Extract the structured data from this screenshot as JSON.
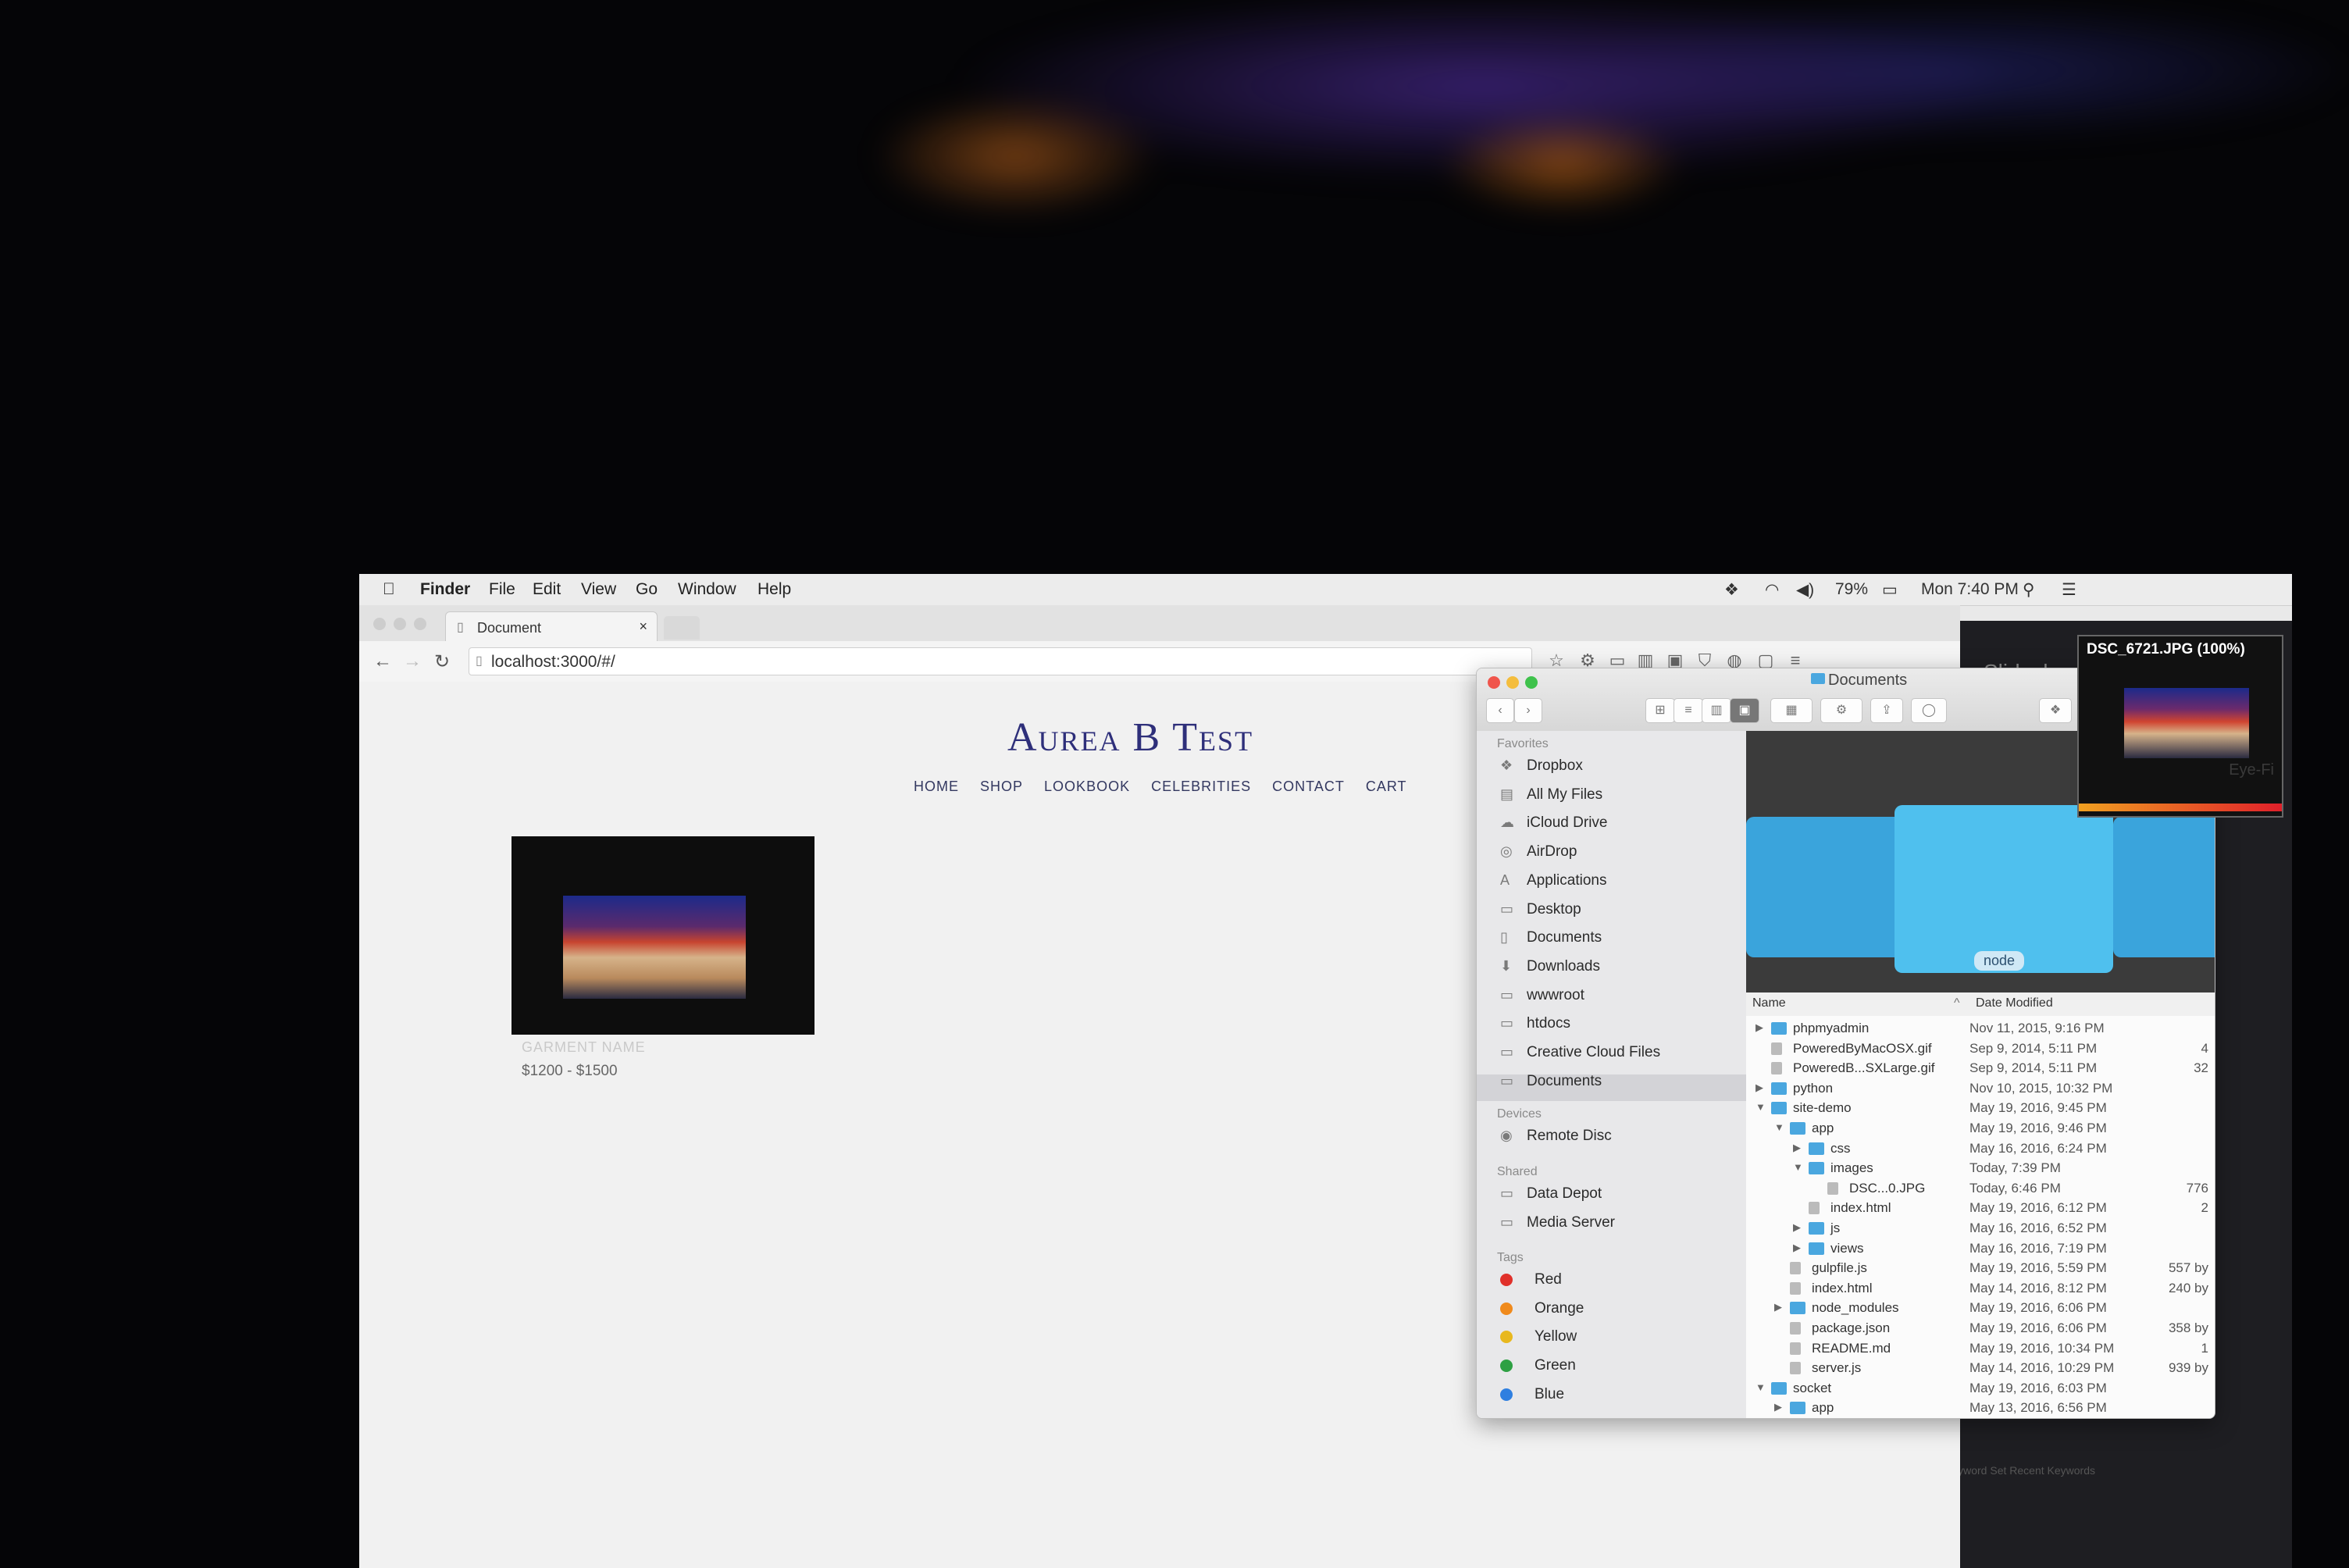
{
  "menubar": {
    "app_name": "Finder",
    "menus": [
      "File",
      "Edit",
      "View",
      "Go",
      "Window",
      "Help"
    ],
    "battery": "79%",
    "clock": "Mon 7:40 PM"
  },
  "browser": {
    "tab_title": "Document",
    "tab_close": "×",
    "url": "localhost:3000/#/",
    "page": {
      "site_title": "Aurea B Test",
      "nav": [
        "HOME",
        "SHOP",
        "LOOKBOOK",
        "CELEBRITIES",
        "CONTACT",
        "CART"
      ],
      "product_name": "GARMENT NAME",
      "product_price": "$1200 - $1500"
    }
  },
  "finder": {
    "title": "Documents",
    "sidebar": {
      "favorites_heading": "Favorites",
      "favorites": [
        {
          "label": "Dropbox",
          "icon": "dropbox-icon"
        },
        {
          "label": "All My Files",
          "icon": "files-icon"
        },
        {
          "label": "iCloud Drive",
          "icon": "cloud-icon"
        },
        {
          "label": "AirDrop",
          "icon": "airdrop-icon"
        },
        {
          "label": "Applications",
          "icon": "applications-icon"
        },
        {
          "label": "Desktop",
          "icon": "desktop-icon"
        },
        {
          "label": "Documents",
          "icon": "document-icon"
        },
        {
          "label": "Downloads",
          "icon": "download-icon"
        },
        {
          "label": "wwwroot",
          "icon": "folder-icon"
        },
        {
          "label": "htdocs",
          "icon": "folder-icon"
        },
        {
          "label": "Creative Cloud Files",
          "icon": "folder-icon"
        },
        {
          "label": "Documents",
          "icon": "folder-icon"
        }
      ],
      "devices_heading": "Devices",
      "devices": [
        {
          "label": "Remote Disc",
          "icon": "disc-icon"
        }
      ],
      "shared_heading": "Shared",
      "shared": [
        {
          "label": "Data Depot",
          "icon": "monitor-icon"
        },
        {
          "label": "Media Server",
          "icon": "monitor-icon"
        }
      ],
      "tags_heading": "Tags",
      "tags": [
        {
          "label": "Red",
          "color": "#e0302a"
        },
        {
          "label": "Orange",
          "color": "#f08a1c"
        },
        {
          "label": "Yellow",
          "color": "#e8b81e"
        },
        {
          "label": "Green",
          "color": "#2ea043"
        },
        {
          "label": "Blue",
          "color": "#2f7fe0"
        }
      ]
    },
    "preview_label": "node",
    "columns": {
      "name": "Name",
      "date": "Date Modified"
    },
    "rows": [
      {
        "name": "phpmyadmin",
        "date": "Nov 11, 2015, 9:16 PM",
        "size": "",
        "indent": 0,
        "kind": "folder",
        "disc": "▶"
      },
      {
        "name": "PoweredByMacOSX.gif",
        "date": "Sep 9, 2014, 5:11 PM",
        "size": "4",
        "indent": 0,
        "kind": "file",
        "disc": ""
      },
      {
        "name": "PoweredB...SXLarge.gif",
        "date": "Sep 9, 2014, 5:11 PM",
        "size": "32",
        "indent": 0,
        "kind": "file",
        "disc": ""
      },
      {
        "name": "python",
        "date": "Nov 10, 2015, 10:32 PM",
        "size": "",
        "indent": 0,
        "kind": "folder",
        "disc": "▶"
      },
      {
        "name": "site-demo",
        "date": "May 19, 2016, 9:45 PM",
        "size": "",
        "indent": 0,
        "kind": "folder",
        "disc": "▼"
      },
      {
        "name": "app",
        "date": "May 19, 2016, 9:46 PM",
        "size": "",
        "indent": 1,
        "kind": "folder",
        "disc": "▼"
      },
      {
        "name": "css",
        "date": "May 16, 2016, 6:24 PM",
        "size": "",
        "indent": 2,
        "kind": "folder",
        "disc": "▶"
      },
      {
        "name": "images",
        "date": "Today, 7:39 PM",
        "size": "",
        "indent": 2,
        "kind": "folder",
        "disc": "▼"
      },
      {
        "name": "DSC...0.JPG",
        "date": "Today, 6:46 PM",
        "size": "776",
        "indent": 3,
        "kind": "file",
        "disc": ""
      },
      {
        "name": "index.html",
        "date": "May 19, 2016, 6:12 PM",
        "size": "2",
        "indent": 2,
        "kind": "file",
        "disc": ""
      },
      {
        "name": "js",
        "date": "May 16, 2016, 6:52 PM",
        "size": "",
        "indent": 2,
        "kind": "folder",
        "disc": "▶"
      },
      {
        "name": "views",
        "date": "May 16, 2016, 7:19 PM",
        "size": "",
        "indent": 2,
        "kind": "folder",
        "disc": "▶"
      },
      {
        "name": "gulpfile.js",
        "date": "May 19, 2016, 5:59 PM",
        "size": "557 by",
        "indent": 1,
        "kind": "file",
        "disc": ""
      },
      {
        "name": "index.html",
        "date": "May 14, 2016, 8:12 PM",
        "size": "240 by",
        "indent": 1,
        "kind": "file",
        "disc": ""
      },
      {
        "name": "node_modules",
        "date": "May 19, 2016, 6:06 PM",
        "size": "",
        "indent": 1,
        "kind": "folder",
        "disc": "▶"
      },
      {
        "name": "package.json",
        "date": "May 19, 2016, 6:06 PM",
        "size": "358 by",
        "indent": 1,
        "kind": "file",
        "disc": ""
      },
      {
        "name": "README.md",
        "date": "May 19, 2016, 10:34 PM",
        "size": "1",
        "indent": 1,
        "kind": "file",
        "disc": ""
      },
      {
        "name": "server.js",
        "date": "May 14, 2016, 10:29 PM",
        "size": "939 by",
        "indent": 1,
        "kind": "file",
        "disc": ""
      },
      {
        "name": "socket",
        "date": "May 19, 2016, 6:03 PM",
        "size": "",
        "indent": 0,
        "kind": "folder",
        "disc": "▼"
      },
      {
        "name": "app",
        "date": "May 13, 2016, 6:56 PM",
        "size": "",
        "indent": 1,
        "kind": "folder",
        "disc": "▶"
      }
    ]
  },
  "quicklook": {
    "title": "DSC_6721.JPG (100%)",
    "watermark": "Eye-Fi"
  },
  "background_app": {
    "slideshow_text": "Slidesho",
    "keyword_text": "Keyword Set    Recent Keywords"
  }
}
